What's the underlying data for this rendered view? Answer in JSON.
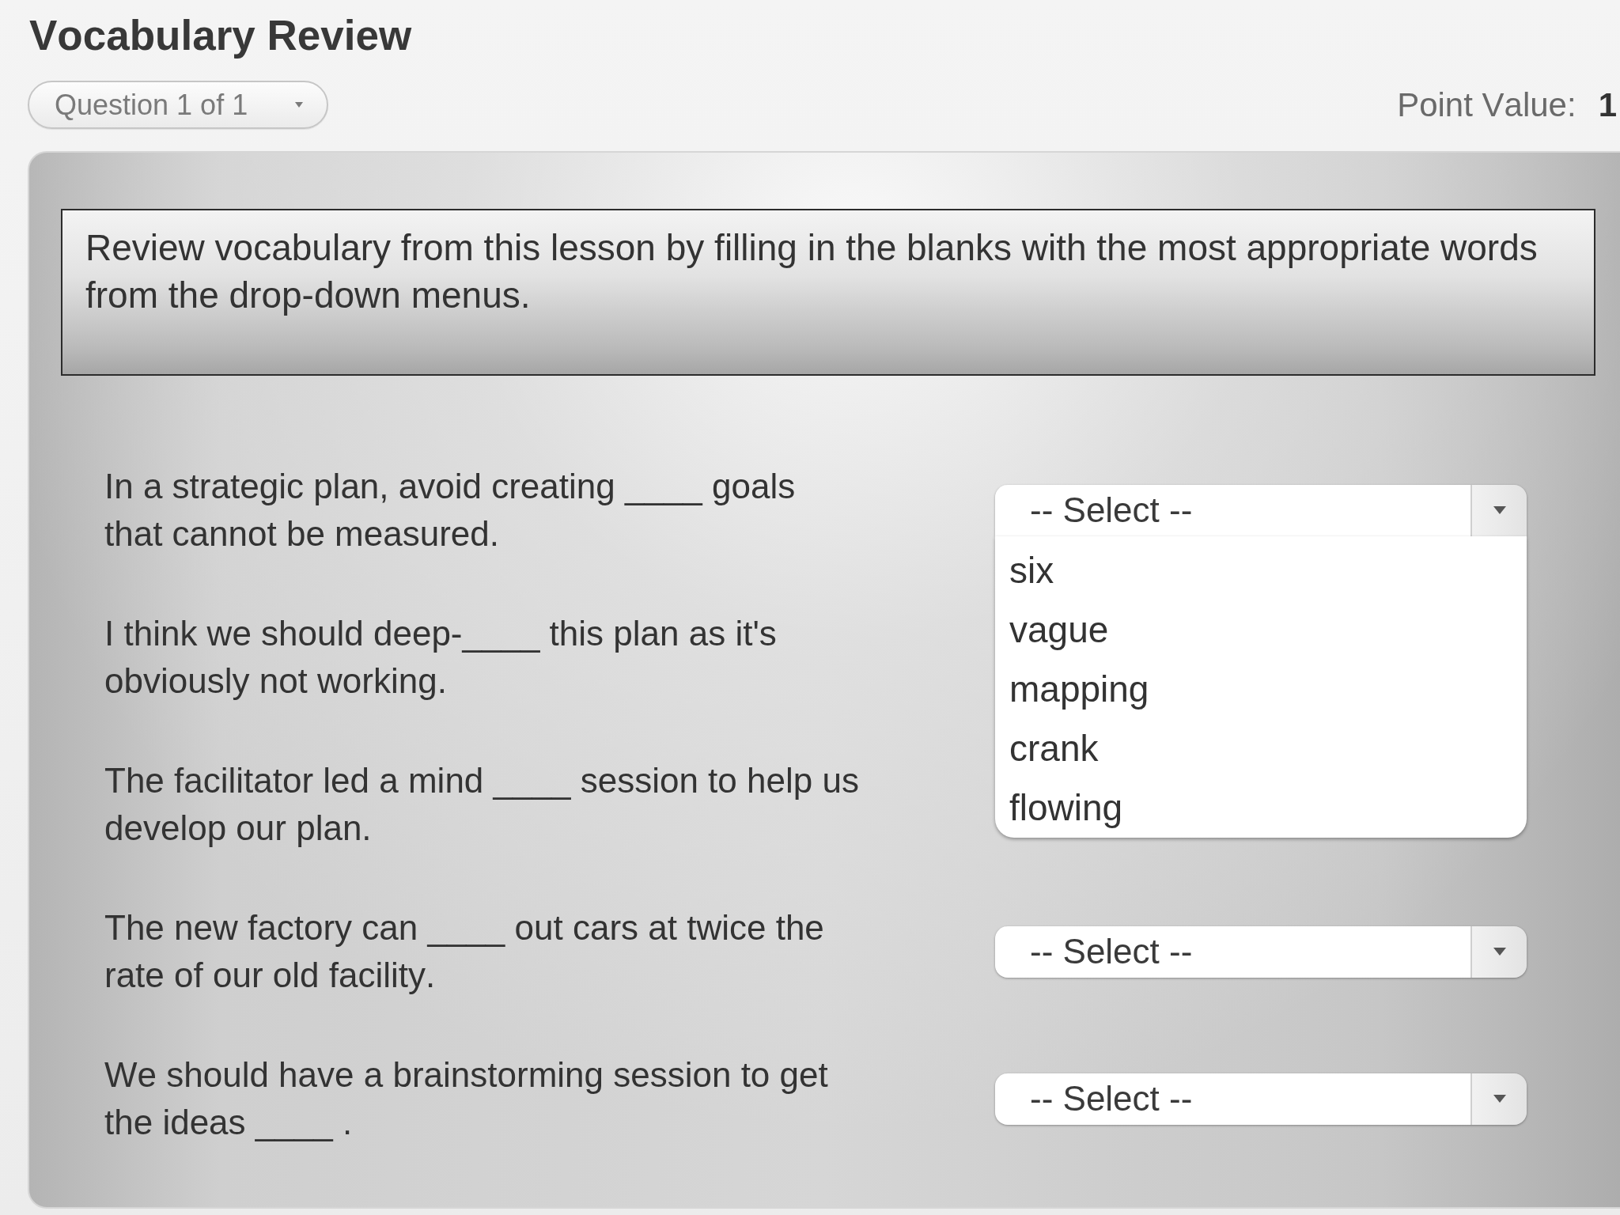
{
  "title": "Vocabulary Review",
  "question_selector": {
    "label": "Question 1 of 1"
  },
  "point_value": {
    "label": "Point Value:",
    "value": "1"
  },
  "instructions": "Review vocabulary from this lesson by filling in the blanks with the most appropriate words from the drop-down menus.",
  "questions": [
    {
      "text": "In a strategic plan, avoid creating ____ goals that cannot be measured.",
      "select": {
        "value": "-- Select --",
        "expanded": true,
        "options": [
          {
            "label": "six",
            "selected": false
          },
          {
            "label": "vague",
            "selected": false
          },
          {
            "label": "mapping",
            "selected": false
          },
          {
            "label": "crank",
            "selected": false
          },
          {
            "label": "flowing",
            "selected": false
          }
        ]
      }
    },
    {
      "text": "I think we should deep-____ this plan as it's obviously not working."
    },
    {
      "text": "The facilitator led a mind ____ session to help us develop our plan."
    },
    {
      "text": "The new factory can ____ out cars at twice the rate of our old facility.",
      "select": {
        "value": "-- Select --",
        "expanded": false
      }
    },
    {
      "text": "We should have a brainstorming session to get the ideas ____ .",
      "select": {
        "value": "-- Select --",
        "expanded": false
      }
    }
  ]
}
